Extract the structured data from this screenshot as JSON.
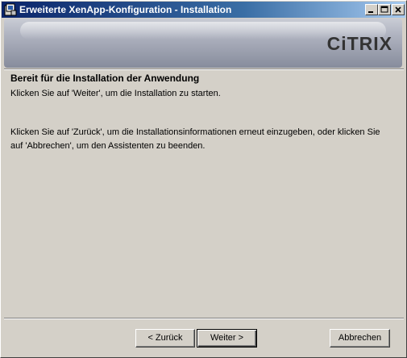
{
  "window": {
    "title": "Erweiterte XenApp-Konfiguration - Installation",
    "controls": {
      "minimize": "minimize-icon",
      "maximize": "maximize-icon",
      "close": "close-icon"
    }
  },
  "banner": {
    "logo": "CiTRIX"
  },
  "content": {
    "heading": "Bereit für die Installation der Anwendung",
    "instruction": "Klicken Sie auf 'Weiter', um die Installation zu starten.",
    "info_line1": "Klicken Sie auf 'Zurück', um die Installationsinformationen erneut einzugeben, oder klicken Sie",
    "info_line2": "auf 'Abbrechen', um den Assistenten zu beenden."
  },
  "buttons": {
    "back": "< Zurück",
    "next": "Weiter >",
    "cancel": "Abbrechen"
  },
  "colors": {
    "face": "#d4d0c8",
    "titlebar_start": "#0a246a",
    "titlebar_end": "#a6caf0"
  }
}
